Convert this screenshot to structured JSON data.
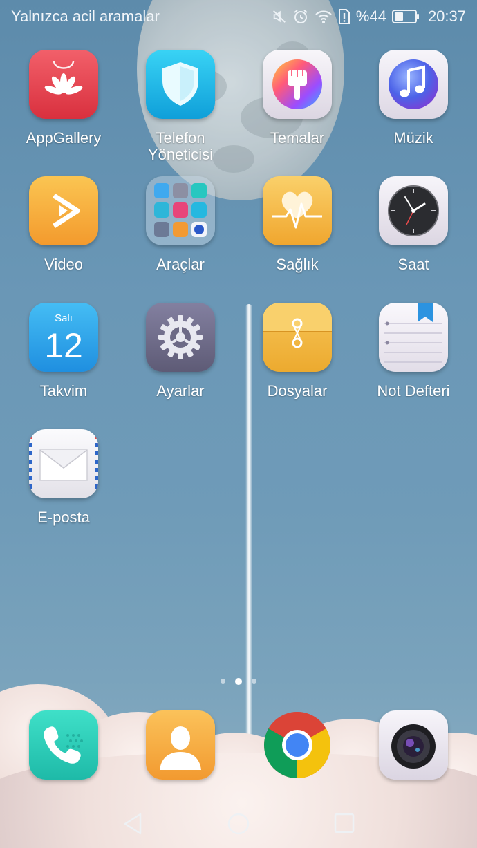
{
  "statusbar": {
    "carrier_text": "Yalnızca acil aramalar",
    "battery_text": "%44",
    "time": "20:37",
    "icons": [
      "mute-icon",
      "alarm-icon",
      "wifi-icon",
      "sim-alert-icon",
      "battery-icon"
    ],
    "battery_level": 0.44
  },
  "apps": [
    {
      "label": "AppGallery",
      "icon": "appgallery-icon"
    },
    {
      "label": "Telefon\nYöneticisi",
      "icon": "phone-manager-icon"
    },
    {
      "label": "Temalar",
      "icon": "themes-icon"
    },
    {
      "label": "Müzik",
      "icon": "music-icon"
    },
    {
      "label": "Video",
      "icon": "video-icon"
    },
    {
      "label": "Araçlar",
      "icon": "tools-folder-icon"
    },
    {
      "label": "Sağlık",
      "icon": "health-icon"
    },
    {
      "label": "Saat",
      "icon": "clock-icon"
    },
    {
      "label": "Takvim",
      "icon": "calendar-icon",
      "calendar_day_name": "Salı",
      "calendar_day": "12"
    },
    {
      "label": "Ayarlar",
      "icon": "settings-icon"
    },
    {
      "label": "Dosyalar",
      "icon": "files-icon"
    },
    {
      "label": "Not Defteri",
      "icon": "notepad-icon"
    },
    {
      "label": "E-posta",
      "icon": "email-icon"
    }
  ],
  "dock": [
    {
      "icon": "phone-icon"
    },
    {
      "icon": "contacts-icon"
    },
    {
      "icon": "chrome-icon"
    },
    {
      "icon": "camera-icon"
    }
  ],
  "page_indicator": {
    "pages": 3,
    "current": 2
  },
  "navigation": [
    "back-icon",
    "home-icon",
    "recents-icon"
  ],
  "colors": {
    "sky": "#6a97b6",
    "appgallery": "#e0404c",
    "phone_manager": "#1fb8e8",
    "video": "#f5a43a",
    "health": "#f2b335",
    "calendar": "#2aa3e6",
    "settings": "#6d6a86",
    "files": "#f0b238",
    "phone": "#2ccfb8",
    "contacts": "#f4a53a"
  }
}
